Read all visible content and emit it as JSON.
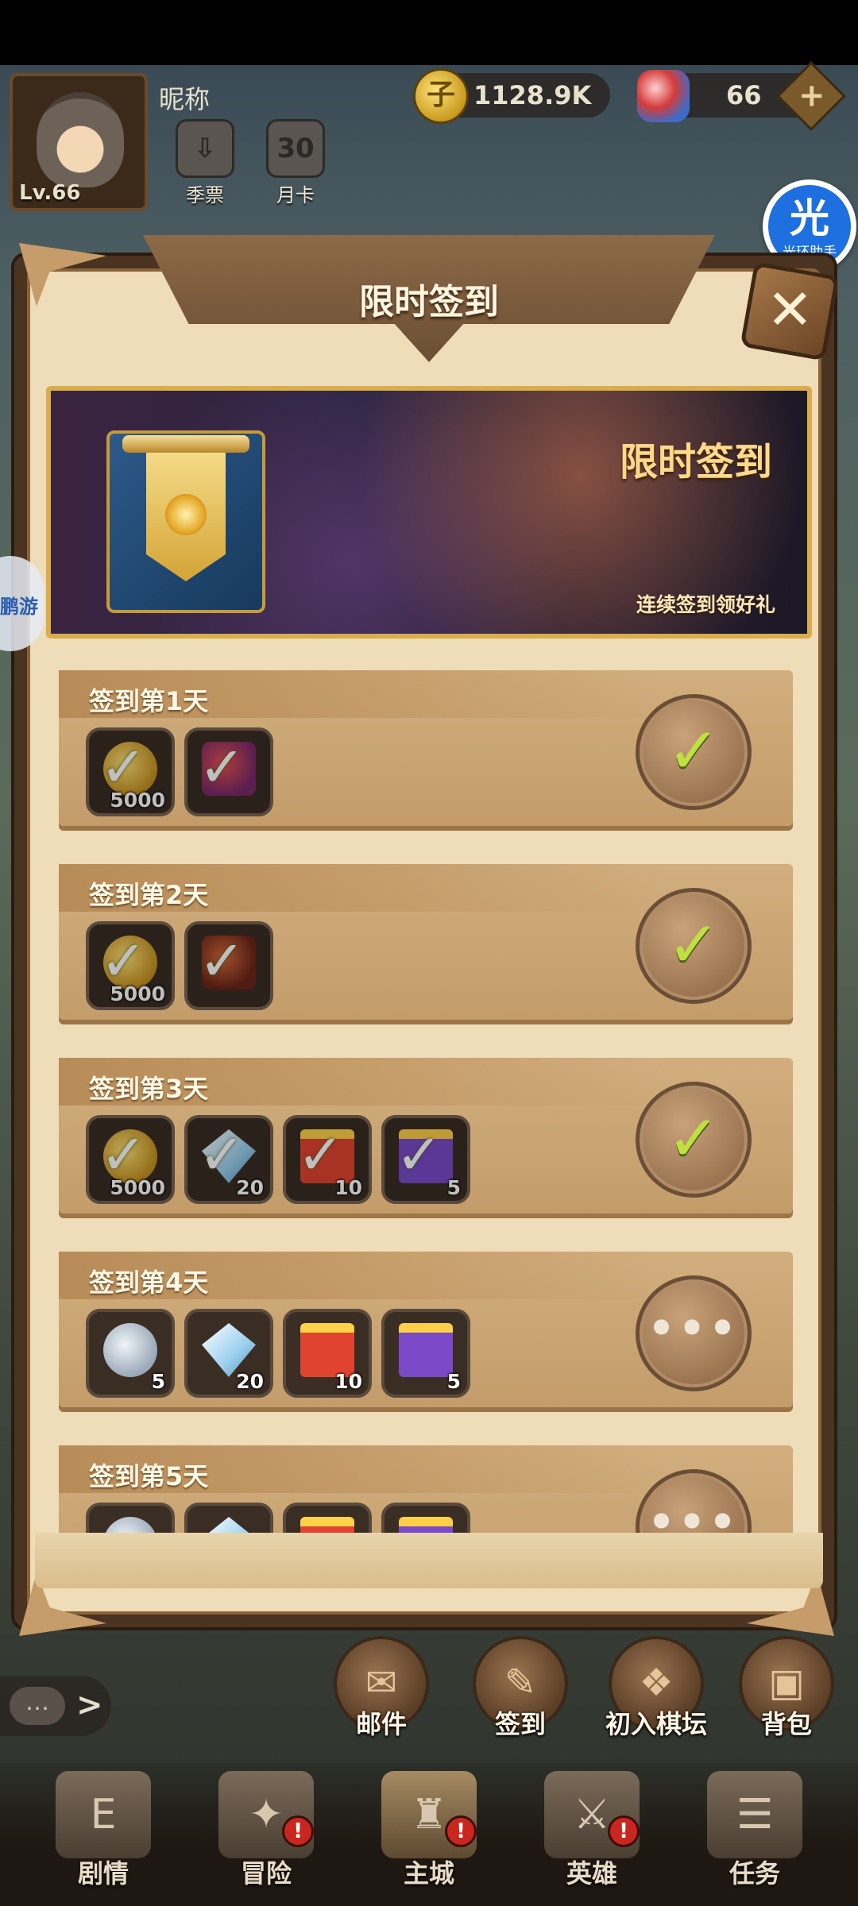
{
  "profile": {
    "nickname": "昵称",
    "level": "Lv.66"
  },
  "top_icons": [
    {
      "label": "季票",
      "icon": "season-pass-icon"
    },
    {
      "label": "月卡",
      "icon": "monthly-card-icon",
      "badge": "30"
    }
  ],
  "resources": {
    "gold": "1128.9K",
    "gems": "66",
    "coin_glyph": "子",
    "plus_glyph": "+"
  },
  "assistant": {
    "glyph": "光",
    "label": "光环助手"
  },
  "side_float": {
    "label": "鹏游"
  },
  "panel": {
    "title": "限时签到",
    "close_glyph": "✕"
  },
  "banner": {
    "title": "限时签到",
    "subtitle": "连续签到领好礼"
  },
  "days": [
    {
      "label": "签到第1天",
      "status": "claimed",
      "rewards": [
        {
          "icon": "coin",
          "qty": "5000"
        },
        {
          "icon": "scroll",
          "qty": ""
        }
      ]
    },
    {
      "label": "签到第2天",
      "status": "claimed",
      "rewards": [
        {
          "icon": "coin",
          "qty": "5000"
        },
        {
          "icon": "chest",
          "qty": ""
        }
      ]
    },
    {
      "label": "签到第3天",
      "status": "claimed",
      "rewards": [
        {
          "icon": "coin",
          "qty": "5000"
        },
        {
          "icon": "crystal",
          "qty": "20"
        },
        {
          "icon": "gift-red",
          "qty": "10"
        },
        {
          "icon": "gift-purple",
          "qty": "5"
        }
      ]
    },
    {
      "label": "签到第4天",
      "status": "pending",
      "rewards": [
        {
          "icon": "key",
          "qty": "5"
        },
        {
          "icon": "crystal",
          "qty": "20"
        },
        {
          "icon": "gift-red",
          "qty": "10"
        },
        {
          "icon": "gift-purple",
          "qty": "5"
        }
      ]
    },
    {
      "label": "签到第5天",
      "status": "pending",
      "rewards": [
        {
          "icon": "key",
          "qty": ""
        },
        {
          "icon": "crystal",
          "qty": ""
        },
        {
          "icon": "gift-red",
          "qty": ""
        },
        {
          "icon": "gift-purple",
          "qty": ""
        }
      ]
    }
  ],
  "check_glyph": "✓",
  "pending_glyph": "•••",
  "function_buttons": [
    {
      "label": "邮件",
      "icon": "mail-icon",
      "glyph": "✉"
    },
    {
      "label": "签到",
      "icon": "signin-scroll-icon",
      "glyph": "✎"
    },
    {
      "label": "初入棋坛",
      "icon": "scroll-icon",
      "glyph": "❖"
    },
    {
      "label": "背包",
      "icon": "backpack-icon",
      "glyph": "▣"
    }
  ],
  "chat": {
    "bubble": "…",
    "arrow": ">"
  },
  "nav": [
    {
      "label": "剧情",
      "icon": "story-book-icon",
      "glyph": "E",
      "alert": false
    },
    {
      "label": "冒险",
      "icon": "adventure-shield-icon",
      "glyph": "✦",
      "alert": true
    },
    {
      "label": "主城",
      "icon": "castle-icon",
      "glyph": "♜",
      "alert": true,
      "active": true
    },
    {
      "label": "英雄",
      "icon": "hero-helmet-icon",
      "glyph": "⚔",
      "alert": true
    },
    {
      "label": "任务",
      "icon": "quest-map-icon",
      "glyph": "☰",
      "alert": false
    }
  ],
  "alert_glyph": "!"
}
